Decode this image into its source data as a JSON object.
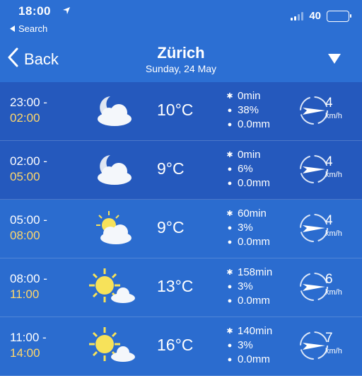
{
  "status_bar": {
    "time": "18:00",
    "back_to_app": "Search",
    "battery_level": "40"
  },
  "nav": {
    "back_label": "Back",
    "city": "Zürich",
    "date": "Sunday, 24 May"
  },
  "forecast": [
    {
      "from": "23:00 -",
      "to": "02:00",
      "icon": "cloudy-night-icon",
      "temp": "10°C",
      "sunshine": "0min",
      "precip_prob": "38%",
      "precip": "0.0mm",
      "wind_speed": "4",
      "wind_unit": "km/h"
    },
    {
      "from": "02:00 -",
      "to": "05:00",
      "icon": "cloudy-night-icon",
      "temp": "9°C",
      "sunshine": "0min",
      "precip_prob": "6%",
      "precip": "0.0mm",
      "wind_speed": "4",
      "wind_unit": "km/h"
    },
    {
      "from": "05:00 -",
      "to": "08:00",
      "icon": "partly-cloudy-icon",
      "temp": "9°C",
      "sunshine": "60min",
      "precip_prob": "3%",
      "precip": "0.0mm",
      "wind_speed": "4",
      "wind_unit": "km/h"
    },
    {
      "from": "08:00 -",
      "to": "11:00",
      "icon": "sun-cloud-icon",
      "temp": "13°C",
      "sunshine": "158min",
      "precip_prob": "3%",
      "precip": "0.0mm",
      "wind_speed": "6",
      "wind_unit": "km/h"
    },
    {
      "from": "11:00 -",
      "to": "14:00",
      "icon": "sun-cloud-icon",
      "temp": "16°C",
      "sunshine": "140min",
      "precip_prob": "3%",
      "precip": "0.0mm",
      "wind_speed": "7",
      "wind_unit": "km/h"
    }
  ]
}
